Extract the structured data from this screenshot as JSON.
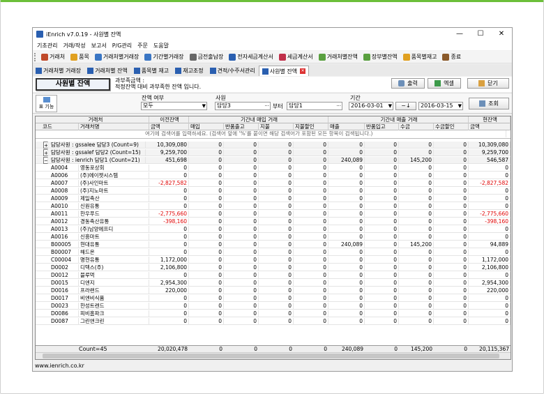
{
  "window": {
    "title": "iEnrich v7.0.19 - 사원별 잔액",
    "minimize": "—",
    "maximize": "☐",
    "close": "✕"
  },
  "menu": [
    "기초관리",
    "거래/작성",
    "보고서",
    "P/G관리",
    "주문",
    "도움말"
  ],
  "toolbar": [
    {
      "label": "거래처",
      "icon": "people-icon",
      "color": "#c04a2a"
    },
    {
      "label": "품목",
      "icon": "box-icon",
      "color": "#e0a020"
    },
    {
      "label": "거래처별거래장",
      "icon": "ledger-icon",
      "color": "#3a76c4"
    },
    {
      "label": "기간별거래장",
      "icon": "calendar-ledger-icon",
      "color": "#3a76c4"
    },
    {
      "label": "금전출납장",
      "icon": "cashbook-icon",
      "color": "#666666"
    },
    {
      "label": "전자세금계산서",
      "icon": "e-tax-icon",
      "color": "#2a5fb0"
    },
    {
      "label": "세금계산서",
      "icon": "tax-invoice-icon",
      "color": "#c0304a"
    },
    {
      "label": "거래처별잔액",
      "icon": "balance-icon",
      "color": "#5aa040"
    },
    {
      "label": "장부별잔액",
      "icon": "book-balance-icon",
      "color": "#5aa040"
    },
    {
      "label": "품목별재고",
      "icon": "stock-icon",
      "color": "#e0a020"
    },
    {
      "label": "종료",
      "icon": "exit-icon",
      "color": "#8a5a2a"
    }
  ],
  "tabs": [
    {
      "label": "거래처별 거래장",
      "active": false
    },
    {
      "label": "거래처별 잔액",
      "active": false
    },
    {
      "label": "품목별 재고",
      "active": false
    },
    {
      "label": "재고조정",
      "active": false
    },
    {
      "label": "견적/수주서관리",
      "active": false
    },
    {
      "label": "사원별 잔액",
      "active": true
    }
  ],
  "page": {
    "title": "사원별 잔액",
    "desc1": "과부족금액 :",
    "desc2": "적정잔액 대비 과부족한 잔액 입니다."
  },
  "buttons": {
    "print": "출력",
    "excel": "엑셀",
    "close": "닫기",
    "search": "조회",
    "func": "기능"
  },
  "filters": {
    "balance_label": "잔액 여부",
    "balance_value": "모두",
    "employee_label": "사원",
    "employee_from": "담당3",
    "between": "부터",
    "employee_to": "담당1",
    "period_label": "기간",
    "date_from": "2016-03-01",
    "date_to": "2016-03-15"
  },
  "grid": {
    "group_headers": {
      "client": "거래처",
      "prev": "이전잔액",
      "buy": "기간내 매입 거래",
      "sell": "기간내 매출 거래",
      "current": "현잔액"
    },
    "columns": [
      "코드",
      "거래처명",
      "금액",
      "매입",
      "반품출고",
      "지불",
      "지불할인",
      "매출",
      "반품입고",
      "수금",
      "수금할인",
      "금액"
    ],
    "filter_hint": "여기에 검색어를 입력하세요. (검색어 앞에 '%'를 붙이면 해당 검색어가 포함된 모든 항목이 검색됩니다.)",
    "groups": [
      {
        "label": "담당사원 : gssalee 담당3 (Count=9)",
        "expanded": false,
        "values": [
          "10,309,080",
          "0",
          "0",
          "0",
          "0",
          "0",
          "0",
          "0",
          "0",
          "10,309,080"
        ]
      },
      {
        "label": "담당사원 : gssalef 담당2 (Count=15)",
        "expanded": false,
        "values": [
          "9,259,700",
          "0",
          "0",
          "0",
          "0",
          "0",
          "0",
          "0",
          "0",
          "9,259,700"
        ]
      },
      {
        "label": "담당사원 : ienrich 담당1 (Count=21)",
        "expanded": true,
        "values": [
          "451,698",
          "0",
          "0",
          "0",
          "0",
          "240,089",
          "0",
          "145,200",
          "0",
          "546,587"
        ]
      }
    ],
    "rows": [
      {
        "code": "A0004",
        "name": "영동포상회",
        "prev": "0",
        "sale": "0",
        "collect": "0",
        "cur": "0"
      },
      {
        "code": "A0006",
        "name": "(주)에이젯시스템",
        "prev": "0",
        "sale": "0",
        "collect": "0",
        "cur": "0"
      },
      {
        "code": "A0007",
        "name": "(주)사인마트",
        "prev": "-2,827,582",
        "sale": "0",
        "collect": "0",
        "cur": "-2,827,582"
      },
      {
        "code": "A0008",
        "name": "(주)지노마트",
        "prev": "0",
        "sale": "0",
        "collect": "0",
        "cur": "0"
      },
      {
        "code": "A0009",
        "name": "제일축산",
        "prev": "0",
        "sale": "0",
        "collect": "0",
        "cur": "0"
      },
      {
        "code": "A0010",
        "name": "신원유통",
        "prev": "0",
        "sale": "0",
        "collect": "0",
        "cur": "0"
      },
      {
        "code": "A0011",
        "name": "한우푸드",
        "prev": "-2,775,660",
        "sale": "0",
        "collect": "0",
        "cur": "-2,775,660"
      },
      {
        "code": "A0012",
        "name": "경동축산유통",
        "prev": "-398,160",
        "sale": "0",
        "collect": "0",
        "cur": "-398,160"
      },
      {
        "code": "A0013",
        "name": "(주)남양에프디",
        "prev": "0",
        "sale": "0",
        "collect": "0",
        "cur": "0"
      },
      {
        "code": "A0016",
        "name": "신흥마트",
        "prev": "0",
        "sale": "0",
        "collect": "0",
        "cur": "0"
      },
      {
        "code": "B00005",
        "name": "현대유통",
        "prev": "0",
        "sale": "240,089",
        "collect": "145,200",
        "cur": "94,889"
      },
      {
        "code": "B00007",
        "name": "해드온",
        "prev": "0",
        "sale": "0",
        "collect": "0",
        "cur": "0"
      },
      {
        "code": "C00004",
        "name": "명현유통",
        "prev": "1,172,000",
        "sale": "0",
        "collect": "0",
        "cur": "1,172,000"
      },
      {
        "code": "D0002",
        "name": "디텍스(주)",
        "prev": "2,106,800",
        "sale": "0",
        "collect": "0",
        "cur": "2,106,800"
      },
      {
        "code": "D0012",
        "name": "블루먹",
        "prev": "0",
        "sale": "0",
        "collect": "0",
        "cur": "0"
      },
      {
        "code": "D0015",
        "name": "디엔지",
        "prev": "2,954,300",
        "sale": "0",
        "collect": "0",
        "cur": "2,954,300"
      },
      {
        "code": "D0016",
        "name": "프라랜드",
        "prev": "220,000",
        "sale": "0",
        "collect": "0",
        "cur": "220,000"
      },
      {
        "code": "D0017",
        "name": "비엔비식품",
        "prev": "0",
        "sale": "0",
        "collect": "0",
        "cur": "0"
      },
      {
        "code": "D0023",
        "name": "한성트렌드",
        "prev": "0",
        "sale": "0",
        "collect": "0",
        "cur": "0"
      },
      {
        "code": "D0086",
        "name": "피비홈파크",
        "prev": "0",
        "sale": "0",
        "collect": "0",
        "cur": "0"
      },
      {
        "code": "D0087",
        "name": "그린앤크린",
        "prev": "0",
        "sale": "0",
        "collect": "0",
        "cur": "0"
      }
    ],
    "footer": {
      "count": "Count=45",
      "values": [
        "20,020,478",
        "0",
        "0",
        "0",
        "0",
        "240,089",
        "0",
        "145,200",
        "0",
        "20,115,367"
      ]
    }
  },
  "status": "www.ienrich.co.kr"
}
